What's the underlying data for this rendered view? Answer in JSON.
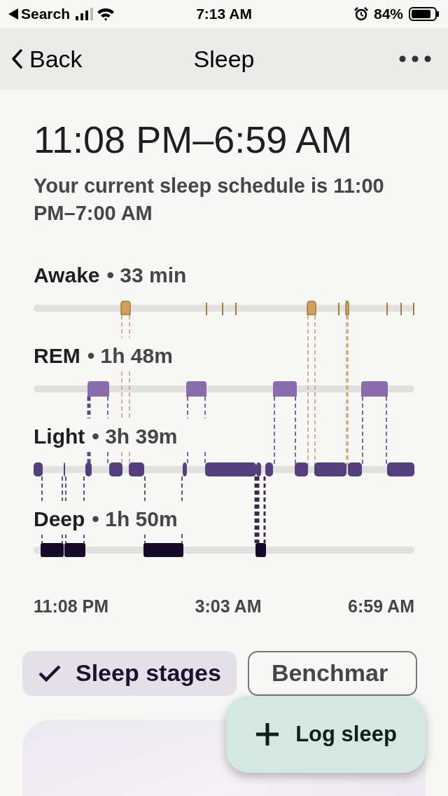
{
  "status_bar": {
    "back_app": "Search",
    "time": "7:13 AM",
    "battery": "84%"
  },
  "nav": {
    "back": "Back",
    "title": "Sleep"
  },
  "sleep": {
    "range": "11:08 PM–6:59 AM",
    "schedule": "Your current sleep schedule is 11:00 PM–7:00 AM"
  },
  "stages": [
    {
      "name": "Awake",
      "duration": "• 33 min"
    },
    {
      "name": "REM",
      "duration": "• 1h 48m"
    },
    {
      "name": "Light",
      "duration": "• 3h 39m"
    },
    {
      "name": "Deep",
      "duration": "• 1h 50m"
    }
  ],
  "axis_labels": [
    "11:08 PM",
    "3:03 AM",
    "6:59 AM"
  ],
  "chips": [
    {
      "label": "Sleep stages",
      "selected": true
    },
    {
      "label": "Benchmar",
      "selected": false
    }
  ],
  "fab": {
    "label": "Log sleep"
  }
}
